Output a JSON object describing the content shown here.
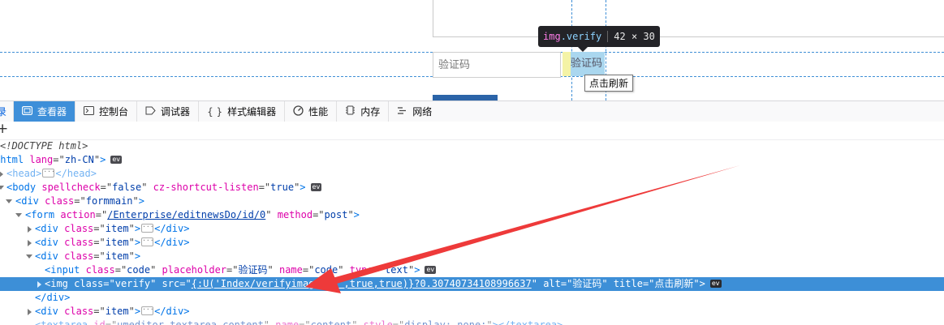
{
  "page": {
    "code_placeholder": "验证码",
    "verify_img_alt": "验证码",
    "title_tooltip": "点击刷新"
  },
  "inspect_tooltip": {
    "tag": "img",
    "cls": ".verify",
    "dims": "42 × 30"
  },
  "devtools": {
    "tabs": [
      {
        "label": "",
        "icon": "cut-off-icon"
      },
      {
        "label": "查看器",
        "icon": "inspector-icon",
        "active": true
      },
      {
        "label": "控制台",
        "icon": "console-icon"
      },
      {
        "label": "调试器",
        "icon": "debugger-icon"
      },
      {
        "label": "样式编辑器",
        "icon": "style-editor-icon"
      },
      {
        "label": "性能",
        "icon": "performance-icon"
      },
      {
        "label": "内存",
        "icon": "memory-icon"
      },
      {
        "label": "网络",
        "icon": "network-icon"
      }
    ],
    "tab_cut_glyph": "录",
    "add_node_glyph": "+"
  },
  "markup": {
    "doctype": "<!DOCTYPE html>",
    "html_lang": "zh-CN",
    "body_spellcheck": "false",
    "body_shortcut": "true",
    "formmain_class": "formmain",
    "form_action": "/Enterprise/editnewsDo/id/0",
    "form_method": "post",
    "item_class": "item",
    "input_class": "code",
    "input_placeholder": "验证码",
    "input_name": "code",
    "input_type": "text",
    "img_class": "verify",
    "img_src_part1": "{:U('Index/verifyimage',",
    "img_src_part2": "'',true,true)}?0.30740734108996637",
    "img_alt": "验证码",
    "img_title": "点击刷新",
    "textarea_id": "umeditor_textarea_content",
    "textarea_name": "content",
    "textarea_style": "display: none;",
    "ev_label": "ev"
  },
  "annotation": {
    "arrow_color": "#ee3a3a"
  }
}
